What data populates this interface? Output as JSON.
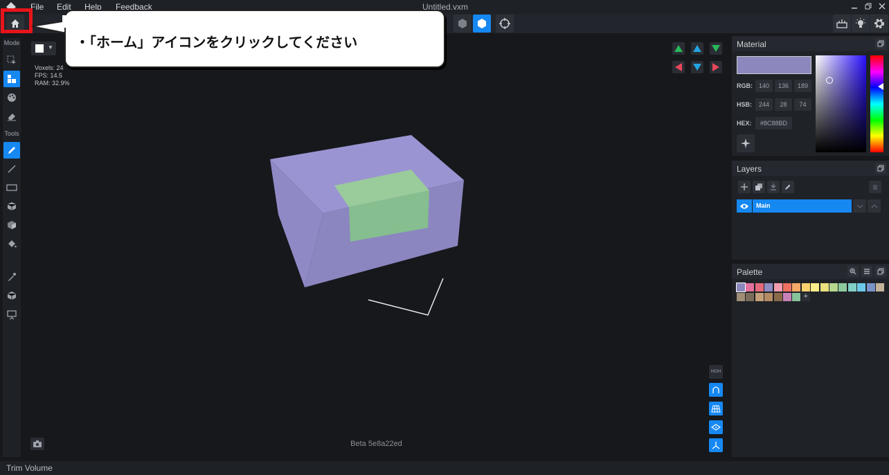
{
  "menubar": {
    "items": [
      "File",
      "Edit",
      "Help",
      "Feedback"
    ],
    "title": "Untitled.vxm"
  },
  "left_tools": {
    "mode_label": "Mode",
    "tools_label": "Tools"
  },
  "viewport": {
    "stats": {
      "voxels": "Voxels: 24",
      "fps": "FPS: 14.5",
      "ram": "RAM: 32.9%"
    },
    "beta": "Beta 5e8a22ed",
    "high_label": "HIGH",
    "current_color": "#FFFFFF"
  },
  "material": {
    "title": "Material",
    "rgb_label": "RGB:",
    "hsb_label": "HSB:",
    "hex_label": "HEX:",
    "rgb": [
      "140",
      "136",
      "189"
    ],
    "hsb": [
      "244",
      "28",
      "74"
    ],
    "hex": "#8C88BD",
    "swatch_color": "#8C88BD"
  },
  "layers": {
    "title": "Layers",
    "items": [
      {
        "name": "Main",
        "visible": true,
        "selected": true
      }
    ]
  },
  "palette": {
    "title": "Palette",
    "colors": [
      "#8C88BD",
      "#E4709C",
      "#E5697A",
      "#8E8CC0",
      "#F29CB0",
      "#EE7060",
      "#F6A868",
      "#F9D26E",
      "#FBEE8A",
      "#EBE27E",
      "#B7D88E",
      "#8CCB9E",
      "#82CFC6",
      "#6EC8E8",
      "#7A94C8",
      "#C2B49A",
      "#A08E76",
      "#7C6C5A",
      "#C4A078",
      "#B48C64",
      "#8A6A48",
      "#C882B8",
      "#88C49A"
    ]
  },
  "status": {
    "text": "Trim Volume"
  },
  "callout": {
    "text": "・「ホーム」アイコンをクリックしてください"
  }
}
